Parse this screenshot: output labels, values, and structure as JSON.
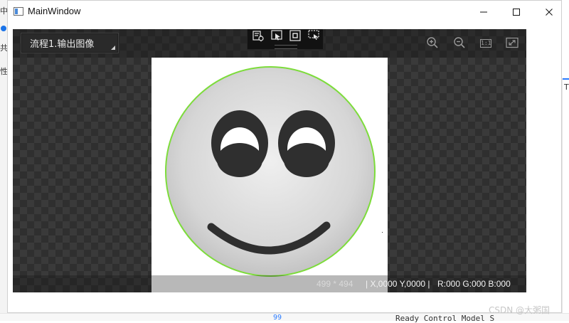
{
  "window": {
    "title": "MainWindow",
    "controls": {
      "minimize_icon": "minimize-icon",
      "maximize_icon": "maximize-icon",
      "close_icon": "close-icon"
    }
  },
  "viewer": {
    "dropdown": {
      "selected": "流程1.输出图像"
    },
    "toolbar": {
      "tools": [
        {
          "icon": "roi-settings-icon"
        },
        {
          "icon": "select-pointer-icon"
        },
        {
          "icon": "frame-icon"
        },
        {
          "icon": "region-select-icon"
        }
      ]
    },
    "zoom": {
      "zoom_in_icon": "zoom-in-icon",
      "zoom_out_icon": "zoom-out-icon",
      "actual_size_label": "1:1",
      "fit_icon": "fit-to-window-icon"
    },
    "status": {
      "image_size": "499 * 494",
      "coordinates": "| X,0000  Y,0000  |",
      "rgb": "R:000  G:000  B:000"
    }
  },
  "background_fragments": {
    "left_chars": [
      "中",
      "共",
      "性"
    ],
    "bottom_code": "Ready Control Model S",
    "bottom_number": "99",
    "right_char": "T"
  },
  "watermark": {
    "text": "CSDN @大粥国"
  },
  "colors": {
    "viewer_bg": "#2f2f2f",
    "circle_outline": "#7ddc3b",
    "face_fill_center": "#eeeeee",
    "face_fill_edge": "#bdbdbd",
    "features": "#2f2f2f"
  }
}
